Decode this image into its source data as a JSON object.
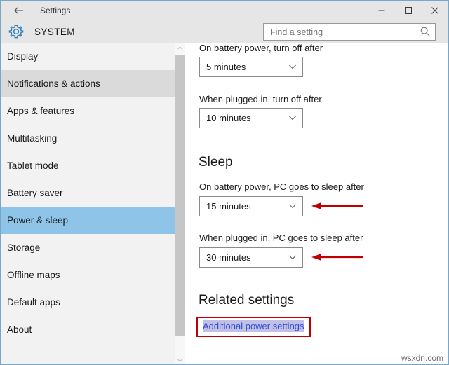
{
  "window": {
    "title": "Settings",
    "back_icon": "back-arrow-icon",
    "controls": {
      "minimize": "minimize-icon",
      "maximize": "maximize-icon",
      "close": "close-icon"
    }
  },
  "header": {
    "icon": "gear-icon",
    "title": "SYSTEM",
    "search": {
      "placeholder": "Find a setting",
      "value": "",
      "icon": "search-icon"
    }
  },
  "sidebar": {
    "items": [
      {
        "label": "Display",
        "state": "normal"
      },
      {
        "label": "Notifications & actions",
        "state": "hovered"
      },
      {
        "label": "Apps & features",
        "state": "normal"
      },
      {
        "label": "Multitasking",
        "state": "normal"
      },
      {
        "label": "Tablet mode",
        "state": "normal"
      },
      {
        "label": "Battery saver",
        "state": "normal"
      },
      {
        "label": "Power & sleep",
        "state": "selected"
      },
      {
        "label": "Storage",
        "state": "normal"
      },
      {
        "label": "Offline maps",
        "state": "normal"
      },
      {
        "label": "Default apps",
        "state": "normal"
      },
      {
        "label": "About",
        "state": "normal"
      }
    ],
    "scrollbar": {
      "up_icon": "chevron-up-icon",
      "down_icon": "chevron-down-icon"
    },
    "selected_color": "#8ec4e8",
    "hover_color": "#dadada"
  },
  "content": {
    "screen_section": {
      "fields": [
        {
          "label": "On battery power, turn off after",
          "value": "5 minutes",
          "chevron": "chevron-down-icon"
        },
        {
          "label": "When plugged in, turn off after",
          "value": "10 minutes",
          "chevron": "chevron-down-icon"
        }
      ]
    },
    "sleep_section": {
      "heading": "Sleep",
      "fields": [
        {
          "label": "On battery power, PC goes to sleep after",
          "value": "15 minutes",
          "chevron": "chevron-down-icon"
        },
        {
          "label": "When plugged in, PC goes to sleep after",
          "value": "30 minutes",
          "chevron": "chevron-down-icon"
        }
      ]
    },
    "related_section": {
      "heading": "Related settings",
      "link": "Additional power settings"
    }
  },
  "annotations": {
    "arrow_color": "#c00000",
    "highlight_border_color": "#c00000",
    "link_highlight_color": "#c3c0e8",
    "arrows": [
      {
        "name": "arrow-to-battery-sleep-dropdown"
      },
      {
        "name": "arrow-to-plugged-sleep-dropdown"
      }
    ]
  },
  "watermark": "wsxdn.com"
}
